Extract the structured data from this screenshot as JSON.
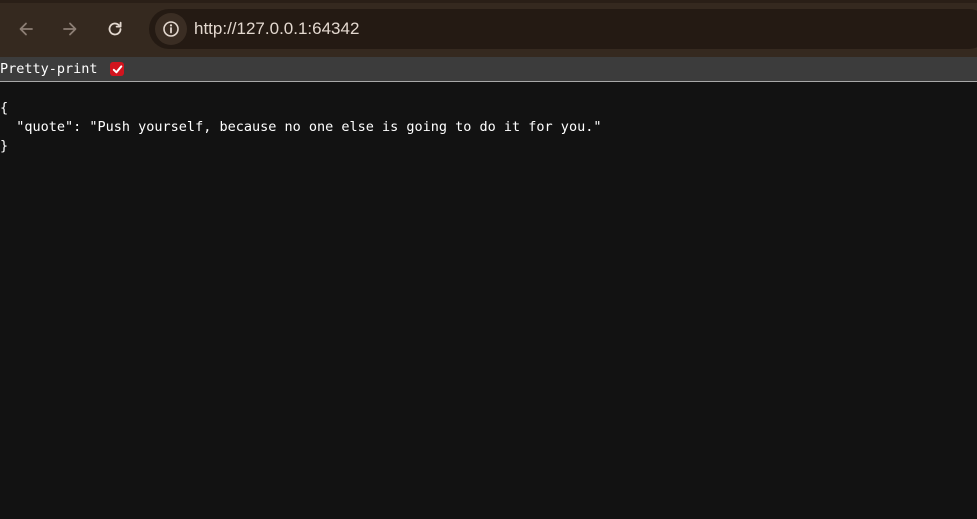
{
  "browser": {
    "url": "http://127.0.0.1:64342",
    "icons": {
      "back": "arrow-left-icon",
      "forward": "arrow-right-icon",
      "reload": "reload-icon",
      "site_info": "info-icon"
    }
  },
  "pretty_print": {
    "label": "Pretty-print",
    "checked": true,
    "check_color": "#d2141e"
  },
  "json_view": {
    "open_brace": "{",
    "line": "  \"quote\": \"Push yourself, because no one else is going to do it for you.\"",
    "close_brace": "}"
  }
}
